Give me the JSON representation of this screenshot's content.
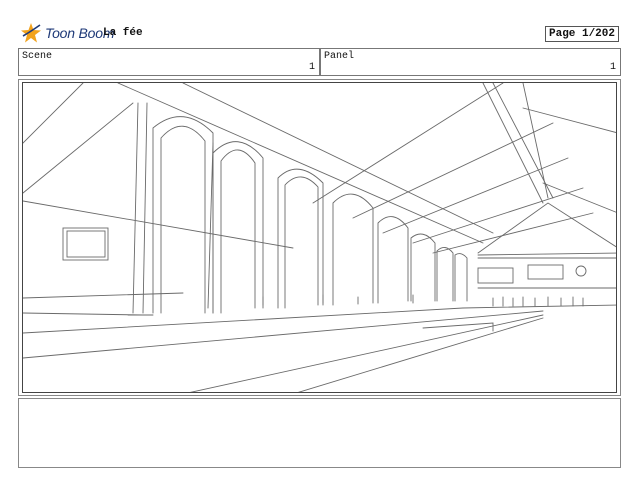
{
  "header": {
    "brand": "Toon Boom",
    "project_title": "La fée",
    "page_label": "Page",
    "page_value": "1/202"
  },
  "scene": {
    "label": "Scene",
    "value": "1"
  },
  "panel": {
    "label": "Panel",
    "value": "1"
  },
  "colors": {
    "brand_blue": "#1f3a78",
    "brand_orange": "#f2a21b",
    "sketch": "#6a6a6a"
  }
}
